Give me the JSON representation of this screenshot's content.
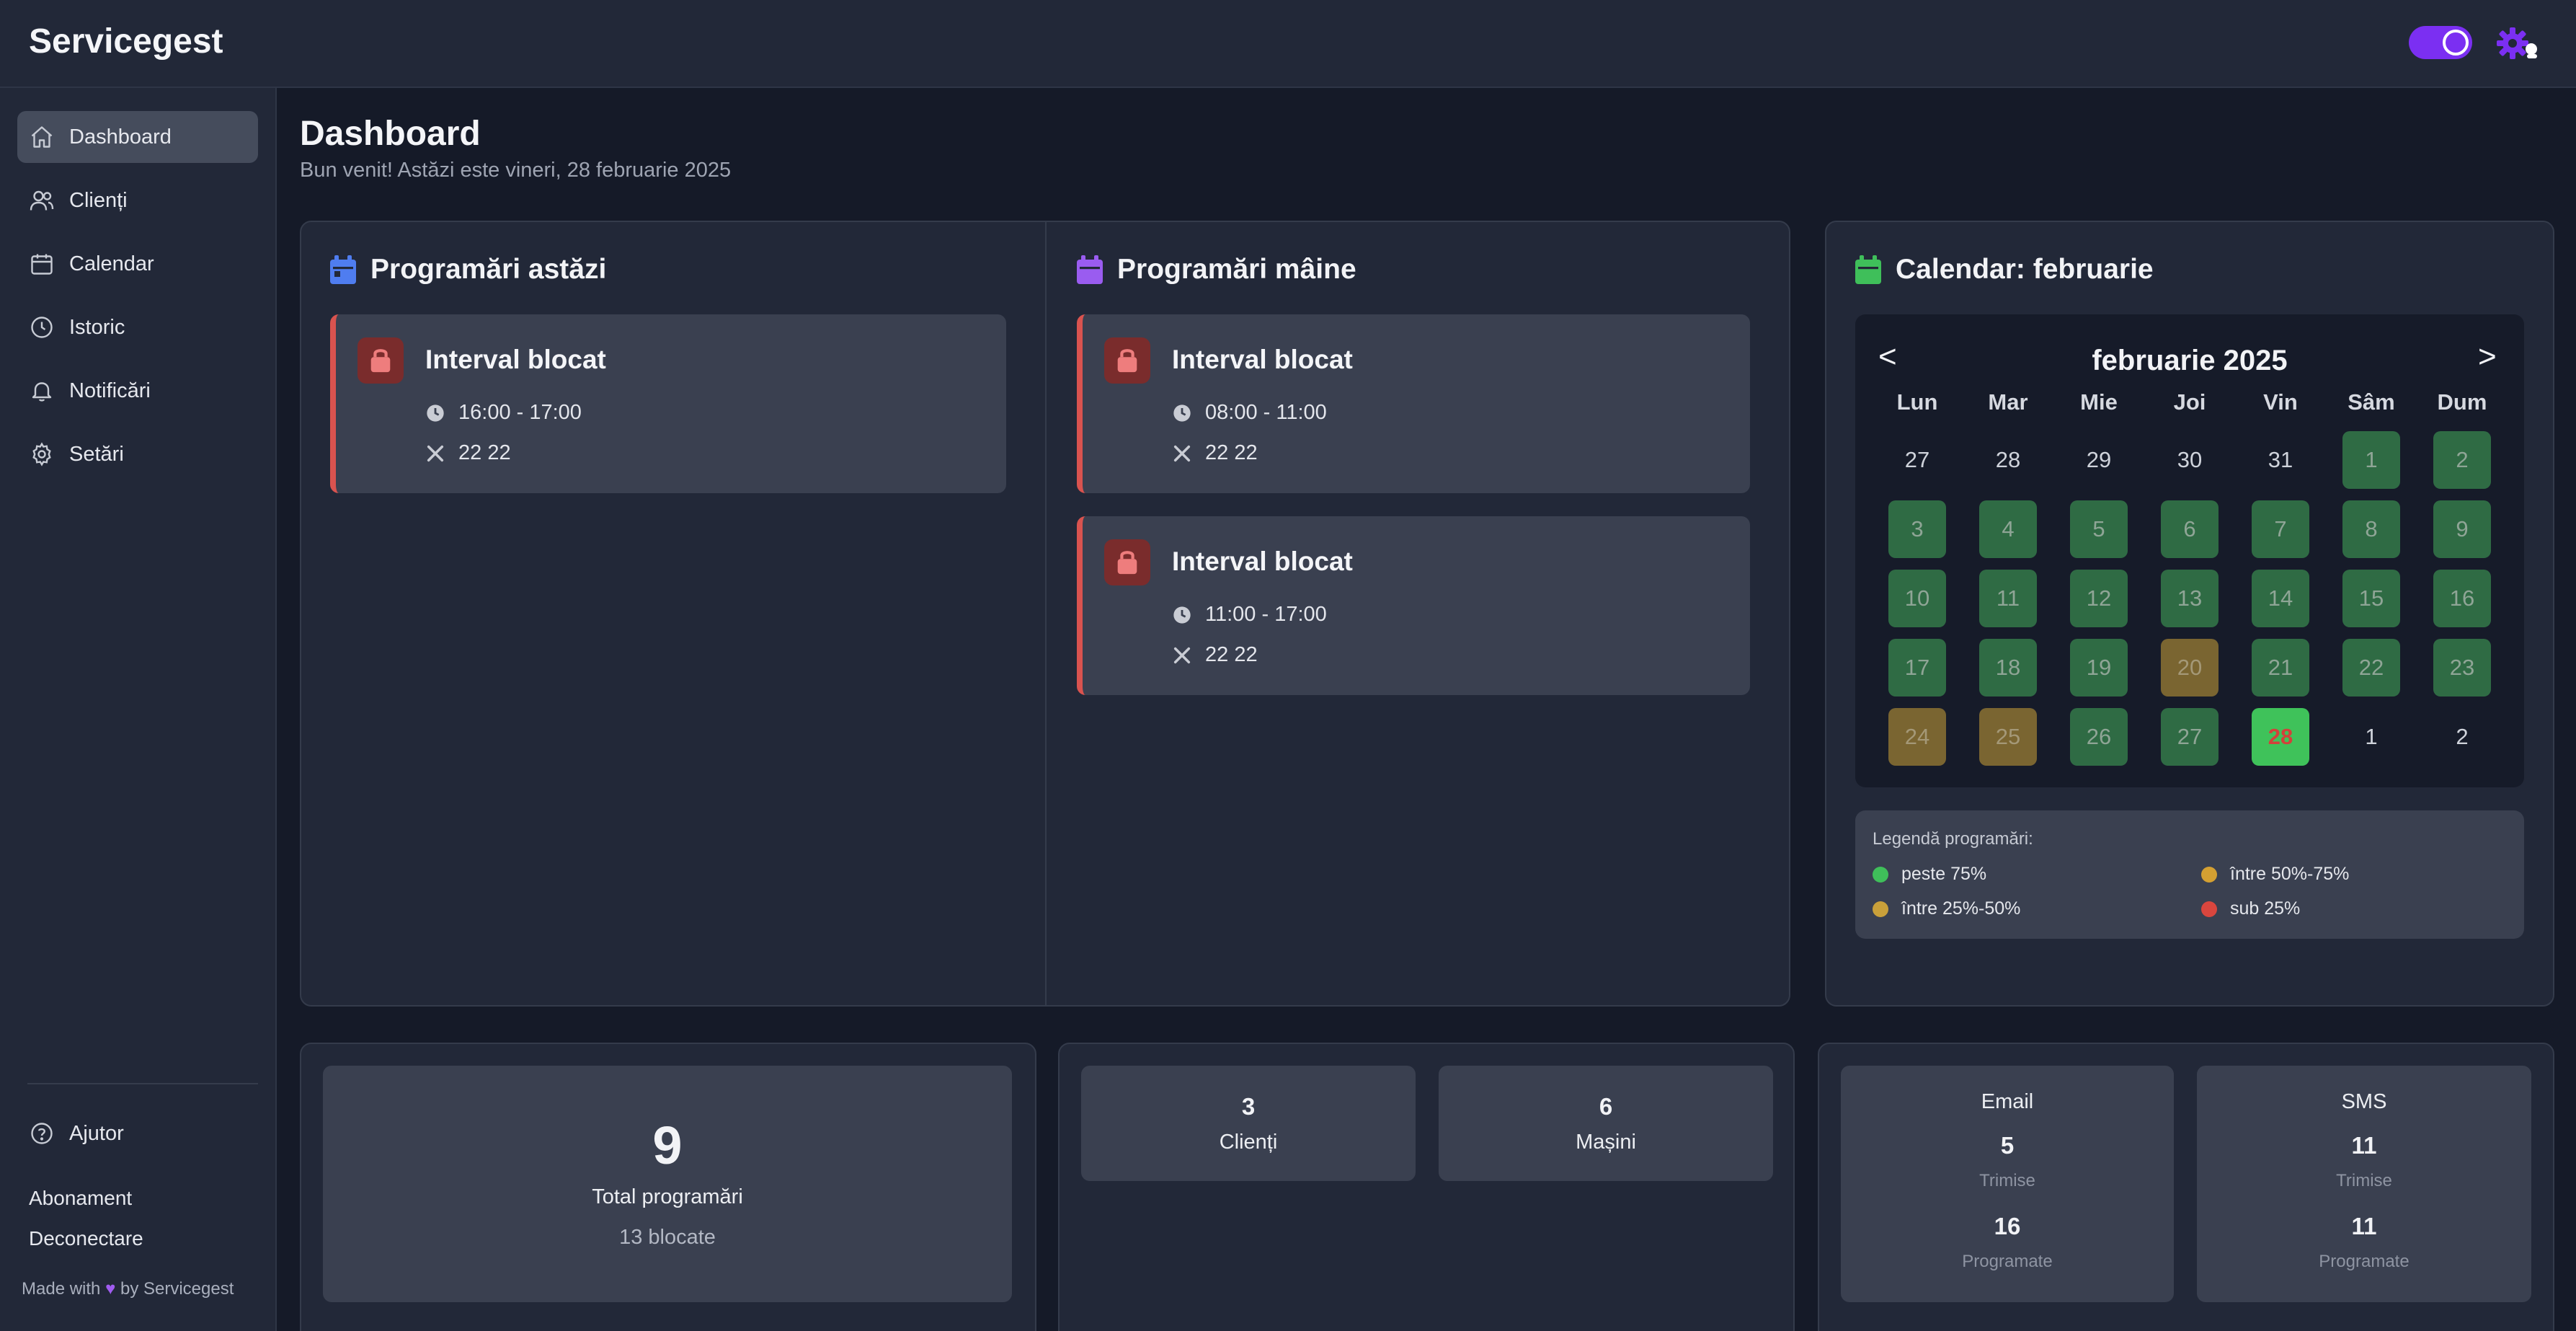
{
  "app": {
    "brand": "Servicegest"
  },
  "sidebar": {
    "items": [
      {
        "label": "Dashboard",
        "icon": "home-icon",
        "active": true
      },
      {
        "label": "Clienți",
        "icon": "users-icon"
      },
      {
        "label": "Calendar",
        "icon": "calendar-icon"
      },
      {
        "label": "Istoric",
        "icon": "clock-icon"
      },
      {
        "label": "Notificări",
        "icon": "bell-icon"
      },
      {
        "label": "Setări",
        "icon": "gear-icon"
      }
    ],
    "help": "Ajutor",
    "subscription": "Abonament",
    "logout": "Deconectare",
    "footer_prefix": "Made with",
    "footer_suffix": "by Servicegest"
  },
  "page": {
    "title": "Dashboard",
    "subtitle": "Bun venit! Astăzi este vineri, 28 februarie 2025"
  },
  "today": {
    "title": "Programări astăzi",
    "items": [
      {
        "title": "Interval blocat",
        "time": "16:00 - 17:00",
        "detail": "22 22"
      }
    ]
  },
  "tomorrow": {
    "title": "Programări mâine",
    "items": [
      {
        "title": "Interval blocat",
        "time": "08:00 - 11:00",
        "detail": "22 22"
      },
      {
        "title": "Interval blocat",
        "time": "11:00 - 17:00",
        "detail": "22 22"
      }
    ]
  },
  "calendar": {
    "title": "Calendar: februarie",
    "month_label": "februarie 2025",
    "prev": "<",
    "next": ">",
    "weekdays": [
      "Lun",
      "Mar",
      "Mie",
      "Joi",
      "Vin",
      "Sâm",
      "Dum"
    ],
    "weeks": [
      [
        {
          "d": "27",
          "s": "plain"
        },
        {
          "d": "28",
          "s": "plain"
        },
        {
          "d": "29",
          "s": "plain"
        },
        {
          "d": "30",
          "s": "plain"
        },
        {
          "d": "31",
          "s": "plain"
        },
        {
          "d": "1",
          "s": "green"
        },
        {
          "d": "2",
          "s": "green"
        }
      ],
      [
        {
          "d": "3",
          "s": "green"
        },
        {
          "d": "4",
          "s": "green"
        },
        {
          "d": "5",
          "s": "green"
        },
        {
          "d": "6",
          "s": "green"
        },
        {
          "d": "7",
          "s": "green"
        },
        {
          "d": "8",
          "s": "green"
        },
        {
          "d": "9",
          "s": "green"
        }
      ],
      [
        {
          "d": "10",
          "s": "green"
        },
        {
          "d": "11",
          "s": "green"
        },
        {
          "d": "12",
          "s": "green"
        },
        {
          "d": "13",
          "s": "green"
        },
        {
          "d": "14",
          "s": "green"
        },
        {
          "d": "15",
          "s": "green"
        },
        {
          "d": "16",
          "s": "green"
        }
      ],
      [
        {
          "d": "17",
          "s": "green"
        },
        {
          "d": "18",
          "s": "green"
        },
        {
          "d": "19",
          "s": "green"
        },
        {
          "d": "20",
          "s": "yellow"
        },
        {
          "d": "21",
          "s": "green"
        },
        {
          "d": "22",
          "s": "green"
        },
        {
          "d": "23",
          "s": "green"
        }
      ],
      [
        {
          "d": "24",
          "s": "yellow"
        },
        {
          "d": "25",
          "s": "yellow"
        },
        {
          "d": "26",
          "s": "green"
        },
        {
          "d": "27",
          "s": "green"
        },
        {
          "d": "28",
          "s": "today"
        },
        {
          "d": "1",
          "s": "plain"
        },
        {
          "d": "2",
          "s": "plain"
        }
      ]
    ],
    "colors": {
      "green": "#2f6b44",
      "yellow": "#7a6531",
      "today": "#3fc25a"
    }
  },
  "legend": {
    "title": "Legendă programări:",
    "items": [
      {
        "label": "peste 75%",
        "color": "#3fbf5a"
      },
      {
        "label": "între 50%-75%",
        "color": "#d4a032"
      },
      {
        "label": "între 25%-50%",
        "color": "#c9a03a"
      },
      {
        "label": "sub 25%",
        "color": "#d9463e"
      }
    ]
  },
  "stats": {
    "total_value": "9",
    "total_label": "Total programări",
    "blocked": "13 blocate",
    "clients_value": "3",
    "clients_label": "Clienți",
    "cars_value": "6",
    "cars_label": "Mașini",
    "email": {
      "title": "Email",
      "sent_value": "5",
      "sent_label": "Trimise",
      "scheduled_value": "16",
      "scheduled_label": "Programate"
    },
    "sms": {
      "title": "SMS",
      "sent_value": "11",
      "sent_label": "Trimise",
      "scheduled_value": "11",
      "scheduled_label": "Programate"
    }
  }
}
